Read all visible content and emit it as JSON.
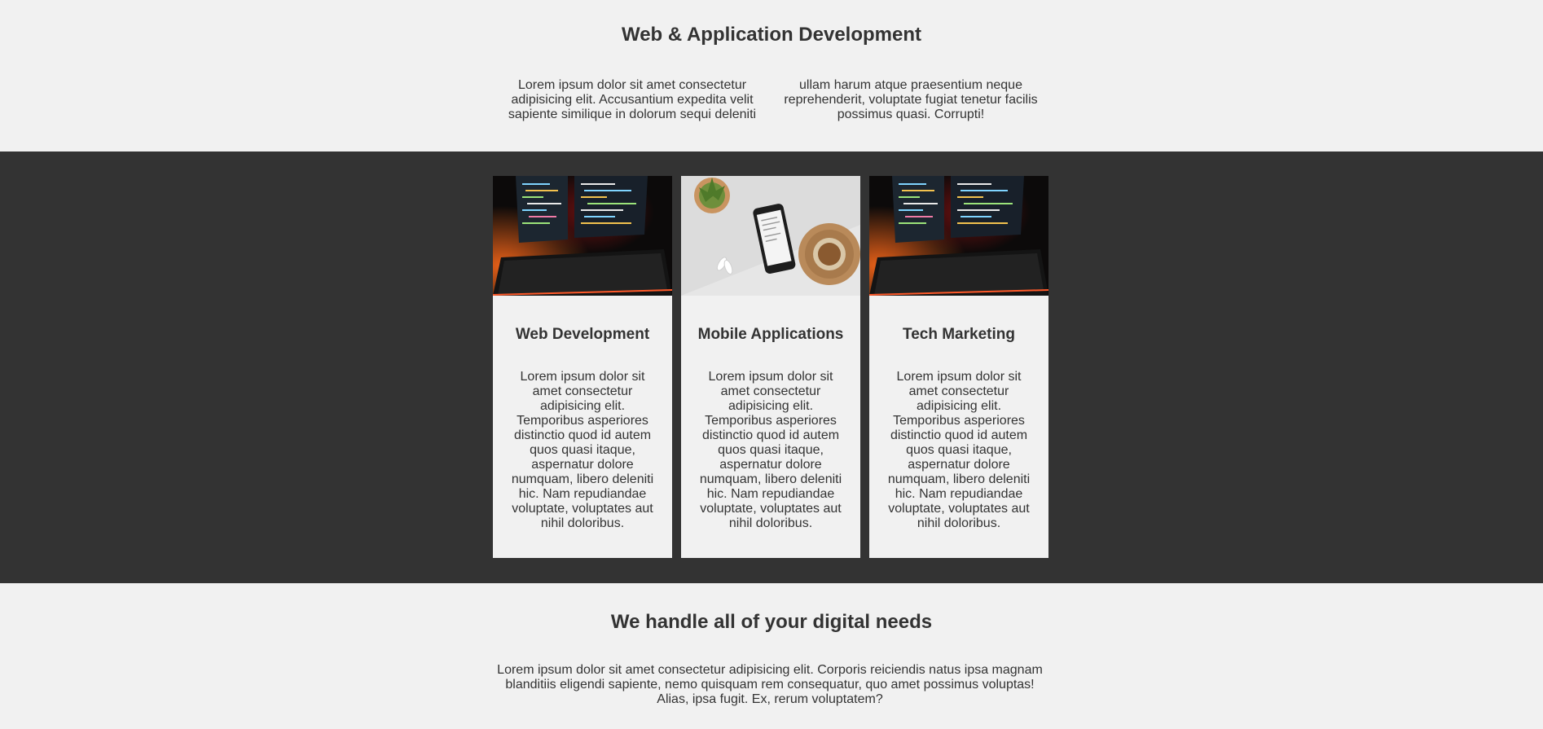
{
  "intro": {
    "title": "Web & Application Development",
    "text": "Lorem ipsum dolor sit amet consectetur adipisicing elit. Accusantium expedita velit sapiente similique in dolorum sequi deleniti ullam harum atque praesentium neque reprehenderit, voluptate fugiat tenetur facilis possimus quasi. Corrupti!"
  },
  "services": {
    "background": "#333333",
    "cards": [
      {
        "image": "laptop-code-image",
        "title": "Web Development",
        "text": "Lorem ipsum dolor sit amet consectetur adipisicing elit. Temporibus asperiores distinctio quod id autem quos quasi itaque, aspernatur dolore numquam, libero deleniti hic. Nam repudiandae voluptate, voluptates aut nihil doloribus."
      },
      {
        "image": "smartphone-desk-image",
        "title": "Mobile Applications",
        "text": "Lorem ipsum dolor sit amet consectetur adipisicing elit. Temporibus asperiores distinctio quod id autem quos quasi itaque, aspernatur dolore numquam, libero deleniti hic. Nam repudiandae voluptate, voluptates aut nihil doloribus."
      },
      {
        "image": "laptop-code-image",
        "title": "Tech Marketing",
        "text": "Lorem ipsum dolor sit amet consectetur adipisicing elit. Temporibus asperiores distinctio quod id autem quos quasi itaque, aspernatur dolore numquam, libero deleniti hic. Nam repudiandae voluptate, voluptates aut nihil doloribus."
      }
    ]
  },
  "outro": {
    "title": "We handle all of your digital needs",
    "text": "Lorem ipsum dolor sit amet consectetur adipisicing elit. Corporis reiciendis natus ipsa magnam blanditiis eligendi sapiente, nemo quisquam rem consequatur, quo amet possimus voluptas! Alias, ipsa fugit. Ex, rerum voluptatem?"
  }
}
